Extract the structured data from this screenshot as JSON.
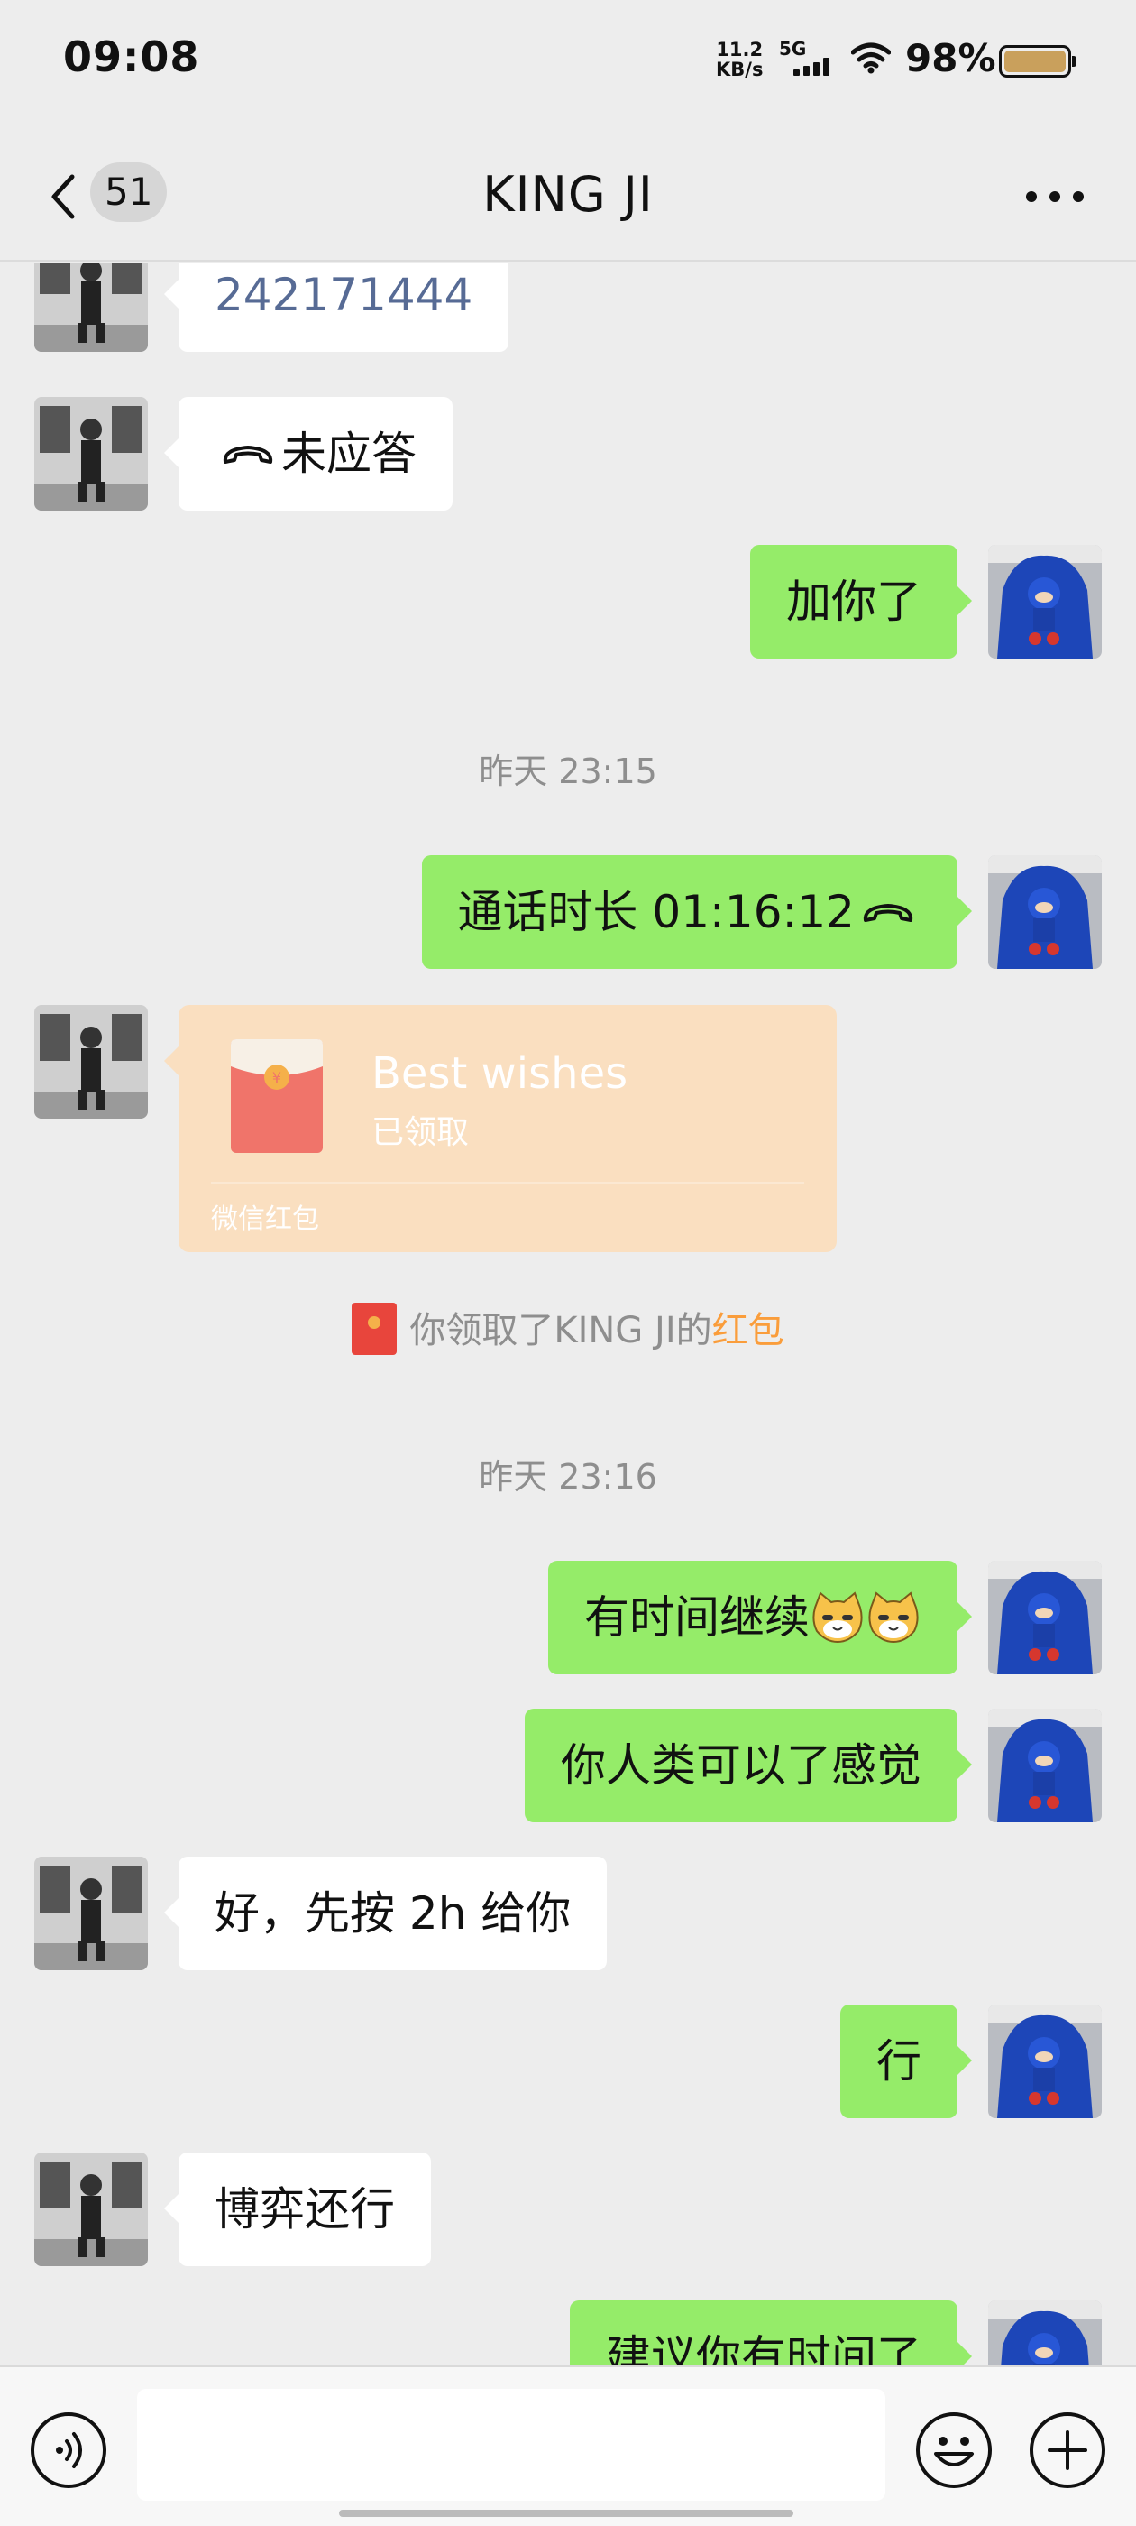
{
  "status_bar": {
    "time": "09:08",
    "net_speed_value": "11.2",
    "net_speed_unit": "KB/s",
    "network_type": "5G",
    "battery_percent": "98%",
    "battery_level": 0.98,
    "battery_color": "#c9a05c",
    "icons": [
      "signal-icon",
      "wifi-icon",
      "battery-icon"
    ]
  },
  "nav": {
    "back_badge": "51",
    "title": "KING JI",
    "icons": [
      "back-icon",
      "more-icon"
    ]
  },
  "messages": [
    {
      "side": "left",
      "text": "242171444",
      "style": "link"
    },
    {
      "side": "left",
      "text": "未应答",
      "icon": "hangup-icon"
    },
    {
      "side": "right",
      "text": "加你了"
    },
    {
      "type": "time",
      "text": "昨天 23:15"
    },
    {
      "side": "right",
      "text": "通话时长 01:16:12",
      "icon": "hangup-icon"
    },
    {
      "side": "left",
      "type": "red_packet",
      "title": "Best wishes",
      "status": "已领取",
      "footer": "微信红包"
    },
    {
      "type": "system",
      "prefix": "你领取了KING JI的",
      "highlight": "红包"
    },
    {
      "type": "time",
      "text": "昨天 23:16"
    },
    {
      "side": "right",
      "text": "有时间继续",
      "emoji": [
        "cat-face-emoji",
        "cat-face-emoji"
      ]
    },
    {
      "side": "right",
      "text": "你人类可以了感觉"
    },
    {
      "side": "left",
      "text": "好，先按 2h 给你"
    },
    {
      "side": "right",
      "text": "行"
    },
    {
      "side": "left",
      "text": "博弈还行"
    },
    {
      "side": "right",
      "text": "建议你有时间了"
    }
  ],
  "input_bar": {
    "placeholder": "",
    "icons": [
      "voice-icon",
      "emoji-icon",
      "plus-icon"
    ]
  },
  "colors": {
    "background": "#ededed",
    "own_bubble": "#95ec69",
    "other_bubble": "#ffffff",
    "link": "#576b95",
    "red_packet_received": "#fadfc0",
    "highlight": "#fa9d3b"
  }
}
